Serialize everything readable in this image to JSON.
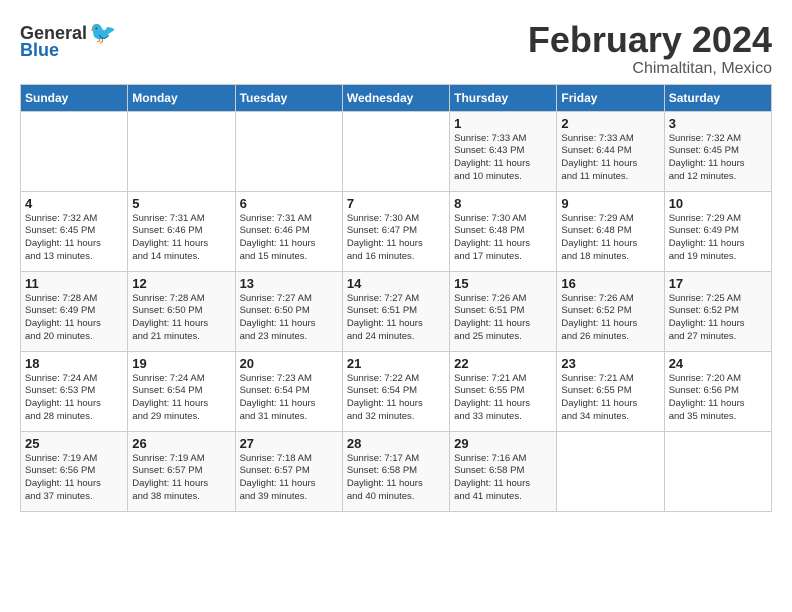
{
  "logo": {
    "general": "General",
    "blue": "Blue"
  },
  "title": "February 2024",
  "subtitle": "Chimaltitan, Mexico",
  "days_of_week": [
    "Sunday",
    "Monday",
    "Tuesday",
    "Wednesday",
    "Thursday",
    "Friday",
    "Saturday"
  ],
  "weeks": [
    [
      {
        "day": "",
        "info": ""
      },
      {
        "day": "",
        "info": ""
      },
      {
        "day": "",
        "info": ""
      },
      {
        "day": "",
        "info": ""
      },
      {
        "day": "1",
        "info": "Sunrise: 7:33 AM\nSunset: 6:43 PM\nDaylight: 11 hours\nand 10 minutes."
      },
      {
        "day": "2",
        "info": "Sunrise: 7:33 AM\nSunset: 6:44 PM\nDaylight: 11 hours\nand 11 minutes."
      },
      {
        "day": "3",
        "info": "Sunrise: 7:32 AM\nSunset: 6:45 PM\nDaylight: 11 hours\nand 12 minutes."
      }
    ],
    [
      {
        "day": "4",
        "info": "Sunrise: 7:32 AM\nSunset: 6:45 PM\nDaylight: 11 hours\nand 13 minutes."
      },
      {
        "day": "5",
        "info": "Sunrise: 7:31 AM\nSunset: 6:46 PM\nDaylight: 11 hours\nand 14 minutes."
      },
      {
        "day": "6",
        "info": "Sunrise: 7:31 AM\nSunset: 6:46 PM\nDaylight: 11 hours\nand 15 minutes."
      },
      {
        "day": "7",
        "info": "Sunrise: 7:30 AM\nSunset: 6:47 PM\nDaylight: 11 hours\nand 16 minutes."
      },
      {
        "day": "8",
        "info": "Sunrise: 7:30 AM\nSunset: 6:48 PM\nDaylight: 11 hours\nand 17 minutes."
      },
      {
        "day": "9",
        "info": "Sunrise: 7:29 AM\nSunset: 6:48 PM\nDaylight: 11 hours\nand 18 minutes."
      },
      {
        "day": "10",
        "info": "Sunrise: 7:29 AM\nSunset: 6:49 PM\nDaylight: 11 hours\nand 19 minutes."
      }
    ],
    [
      {
        "day": "11",
        "info": "Sunrise: 7:28 AM\nSunset: 6:49 PM\nDaylight: 11 hours\nand 20 minutes."
      },
      {
        "day": "12",
        "info": "Sunrise: 7:28 AM\nSunset: 6:50 PM\nDaylight: 11 hours\nand 21 minutes."
      },
      {
        "day": "13",
        "info": "Sunrise: 7:27 AM\nSunset: 6:50 PM\nDaylight: 11 hours\nand 23 minutes."
      },
      {
        "day": "14",
        "info": "Sunrise: 7:27 AM\nSunset: 6:51 PM\nDaylight: 11 hours\nand 24 minutes."
      },
      {
        "day": "15",
        "info": "Sunrise: 7:26 AM\nSunset: 6:51 PM\nDaylight: 11 hours\nand 25 minutes."
      },
      {
        "day": "16",
        "info": "Sunrise: 7:26 AM\nSunset: 6:52 PM\nDaylight: 11 hours\nand 26 minutes."
      },
      {
        "day": "17",
        "info": "Sunrise: 7:25 AM\nSunset: 6:52 PM\nDaylight: 11 hours\nand 27 minutes."
      }
    ],
    [
      {
        "day": "18",
        "info": "Sunrise: 7:24 AM\nSunset: 6:53 PM\nDaylight: 11 hours\nand 28 minutes."
      },
      {
        "day": "19",
        "info": "Sunrise: 7:24 AM\nSunset: 6:54 PM\nDaylight: 11 hours\nand 29 minutes."
      },
      {
        "day": "20",
        "info": "Sunrise: 7:23 AM\nSunset: 6:54 PM\nDaylight: 11 hours\nand 31 minutes."
      },
      {
        "day": "21",
        "info": "Sunrise: 7:22 AM\nSunset: 6:54 PM\nDaylight: 11 hours\nand 32 minutes."
      },
      {
        "day": "22",
        "info": "Sunrise: 7:21 AM\nSunset: 6:55 PM\nDaylight: 11 hours\nand 33 minutes."
      },
      {
        "day": "23",
        "info": "Sunrise: 7:21 AM\nSunset: 6:55 PM\nDaylight: 11 hours\nand 34 minutes."
      },
      {
        "day": "24",
        "info": "Sunrise: 7:20 AM\nSunset: 6:56 PM\nDaylight: 11 hours\nand 35 minutes."
      }
    ],
    [
      {
        "day": "25",
        "info": "Sunrise: 7:19 AM\nSunset: 6:56 PM\nDaylight: 11 hours\nand 37 minutes."
      },
      {
        "day": "26",
        "info": "Sunrise: 7:19 AM\nSunset: 6:57 PM\nDaylight: 11 hours\nand 38 minutes."
      },
      {
        "day": "27",
        "info": "Sunrise: 7:18 AM\nSunset: 6:57 PM\nDaylight: 11 hours\nand 39 minutes."
      },
      {
        "day": "28",
        "info": "Sunrise: 7:17 AM\nSunset: 6:58 PM\nDaylight: 11 hours\nand 40 minutes."
      },
      {
        "day": "29",
        "info": "Sunrise: 7:16 AM\nSunset: 6:58 PM\nDaylight: 11 hours\nand 41 minutes."
      },
      {
        "day": "",
        "info": ""
      },
      {
        "day": "",
        "info": ""
      }
    ]
  ]
}
